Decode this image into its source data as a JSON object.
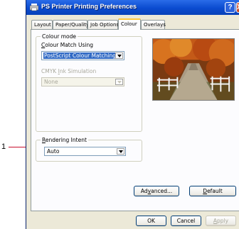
{
  "window": {
    "title": "PS Printer Printing Preferences",
    "help_label": "?",
    "close_label": "X"
  },
  "tabs": [
    {
      "label": "Layout"
    },
    {
      "label": "Paper/Quality"
    },
    {
      "label": "Job Options"
    },
    {
      "label": "Colour",
      "active": true
    },
    {
      "label": "Overlays"
    }
  ],
  "colour_mode": {
    "group_label": "Colour mode",
    "match_label_pre": "",
    "match_label_accel": "C",
    "match_label_post": "olour Match Using",
    "match_value": "PostScript Colour Matching",
    "cmyk_label_pre": "CMYK ",
    "cmyk_label_accel": "I",
    "cmyk_label_post": "nk Simulation",
    "cmyk_value": "None"
  },
  "rendering_intent": {
    "group_label_pre": "",
    "group_label_accel": "R",
    "group_label_post": "endering Intent",
    "value": "Auto"
  },
  "buttons": {
    "advanced_pre": "Ad",
    "advanced_accel": "v",
    "advanced_post": "anced...",
    "default_pre": "",
    "default_accel": "D",
    "default_post": "efault",
    "ok": "OK",
    "cancel": "Cancel",
    "apply_pre": "",
    "apply_accel": "A",
    "apply_post": "pply"
  },
  "callout": {
    "number": "1"
  },
  "colors": {
    "title_bar": "#0a4bd0",
    "selection": "#316ac5",
    "callout": "#c8102e",
    "tab_highlight": "#ffc83c"
  },
  "icons": {
    "app": "printer-icon",
    "preview": "autumn-road-photo"
  }
}
